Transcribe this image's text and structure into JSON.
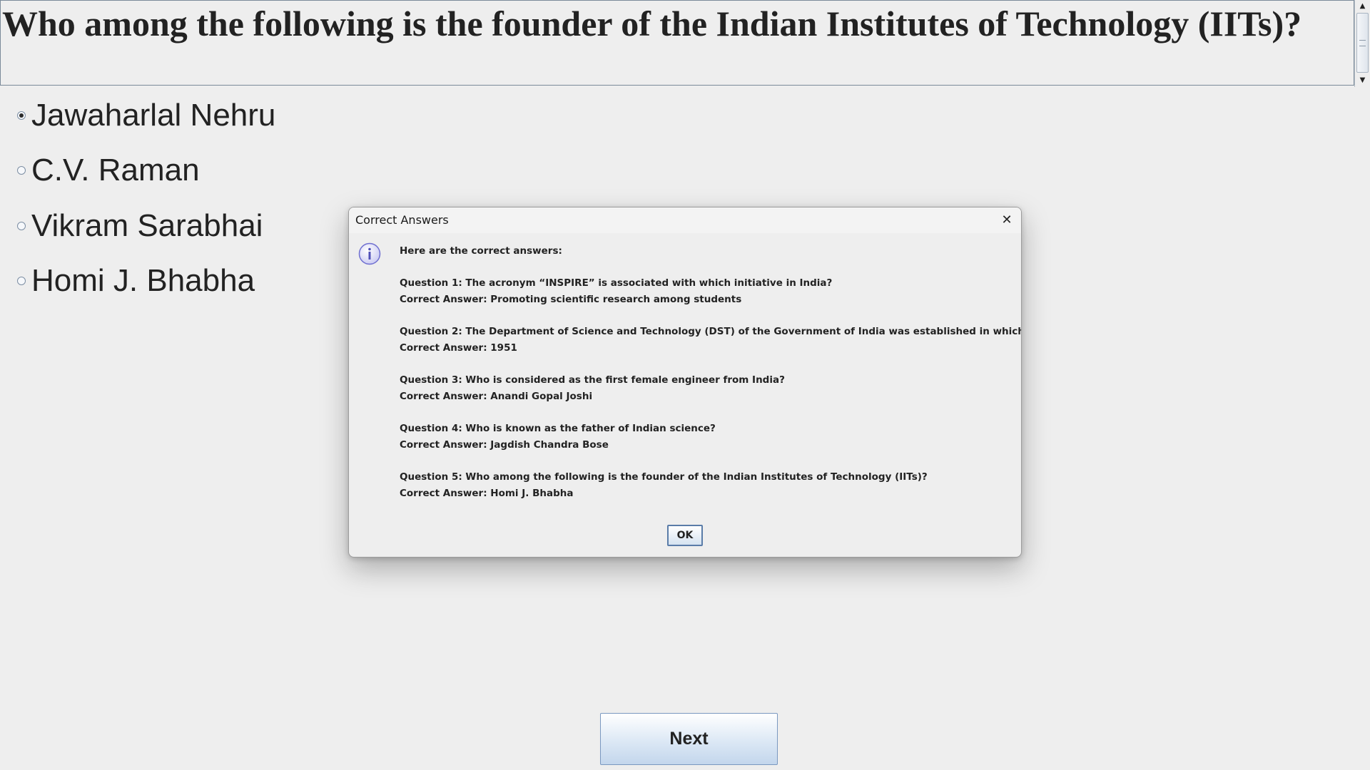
{
  "question": {
    "text": "Who among the following is the founder of the Indian Institutes of  Technology (IITs)?"
  },
  "scrollbar": {
    "up_icon": "arrow-up-icon",
    "down_icon": "arrow-down-icon"
  },
  "options": [
    {
      "label": "Jawaharlal Nehru",
      "selected": true
    },
    {
      "label": "C.V. Raman",
      "selected": false
    },
    {
      "label": "Vikram Sarabhai",
      "selected": false
    },
    {
      "label": "Homi J. Bhabha",
      "selected": false
    }
  ],
  "next_button": {
    "label": "Next"
  },
  "dialog": {
    "title": "Correct Answers",
    "close_icon": "close-icon",
    "info_icon": "info-icon",
    "intro": "Here are the correct answers:",
    "entries": [
      {
        "question": "Question 1: The acronym “INSPIRE” is associated with which initiative in India?",
        "answer": "Correct Answer: Promoting scientific research among students"
      },
      {
        "question": "Question 2: The Department of Science and Technology (DST) of the  Government of India was established in which year?",
        "answer": "Correct Answer: 1951"
      },
      {
        "question": "Question 3:  Who is considered as the first female engineer from India?",
        "answer": "Correct Answer: Anandi Gopal Joshi"
      },
      {
        "question": "Question 4:  Who is known as the father of Indian science?",
        "answer": "Correct Answer: Jagdish Chandra Bose"
      },
      {
        "question": "Question 5: Who among the following is the founder of the Indian Institutes of  Technology (IITs)?",
        "answer": "Correct Answer: Homi J. Bhabha"
      }
    ],
    "ok_label": "OK"
  },
  "colors": {
    "background": "#eeeeee",
    "button_border": "#7a98c0",
    "info_icon": "#6f6fd0"
  }
}
